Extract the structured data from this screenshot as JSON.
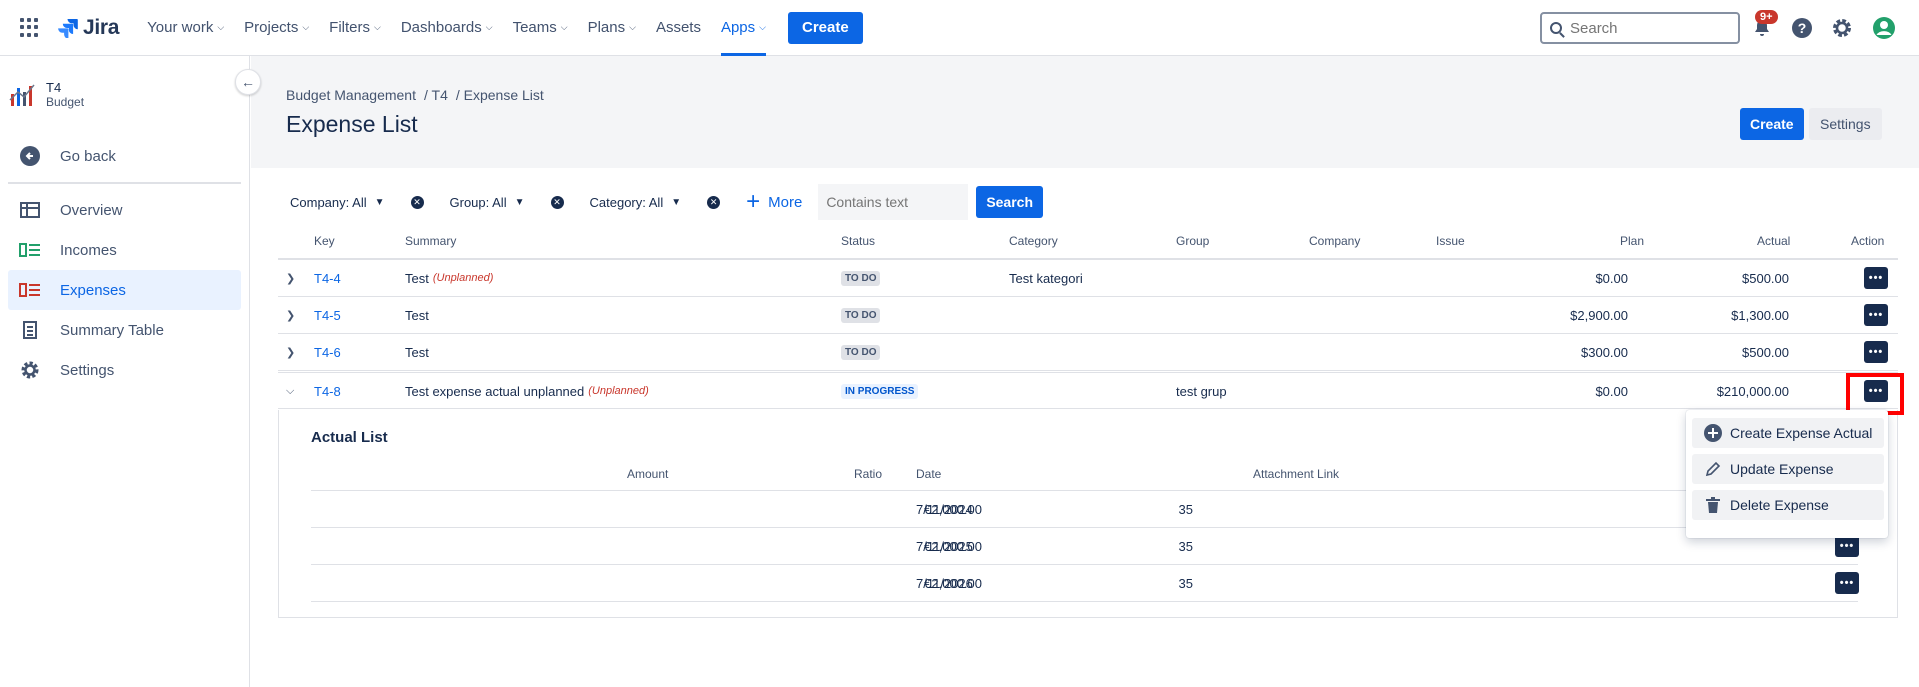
{
  "nav": {
    "logo": "Jira",
    "items": [
      {
        "label": "Your work",
        "chevron": true
      },
      {
        "label": "Projects",
        "chevron": true
      },
      {
        "label": "Filters",
        "chevron": true
      },
      {
        "label": "Dashboards",
        "chevron": true
      },
      {
        "label": "Teams",
        "chevron": true
      },
      {
        "label": "Plans",
        "chevron": true
      },
      {
        "label": "Assets",
        "chevron": false
      },
      {
        "label": "Apps",
        "chevron": true,
        "active": true
      }
    ],
    "create_label": "Create",
    "search_placeholder": "Search",
    "notifications_badge": "9+"
  },
  "sidebar": {
    "project_name": "T4",
    "project_sub": "Budget",
    "go_back": "Go back",
    "items": [
      {
        "label": "Overview",
        "icon": "overview-icon"
      },
      {
        "label": "Incomes",
        "icon": "incomes-icon"
      },
      {
        "label": "Expenses",
        "icon": "expenses-icon",
        "selected": true
      },
      {
        "label": "Summary Table",
        "icon": "summary-table-icon"
      },
      {
        "label": "Settings",
        "icon": "gear-icon"
      }
    ]
  },
  "header": {
    "breadcrumb": [
      "Budget Management",
      "/ T4",
      "/ Expense List"
    ],
    "title": "Expense List",
    "create_label": "Create",
    "settings_label": "Settings"
  },
  "filters": {
    "company": "Company: All",
    "group": "Group: All",
    "category": "Category: All",
    "more": "More",
    "contains_placeholder": "Contains text",
    "search": "Search"
  },
  "table": {
    "columns": [
      "Key",
      "Summary",
      "Status",
      "Category",
      "Group",
      "Company",
      "Issue",
      "Plan",
      "Actual",
      "Action"
    ],
    "rows": [
      {
        "key": "T4-4",
        "summary": "Test",
        "unplanned": "(Unplanned)",
        "status": "TO DO",
        "category": "Test kategori",
        "group": "",
        "plan": "$0.00",
        "actual": "$500.00"
      },
      {
        "key": "T4-5",
        "summary": "Test",
        "unplanned": "",
        "status": "TO DO",
        "category": "",
        "group": "",
        "plan": "$2,900.00",
        "actual": "$1,300.00"
      },
      {
        "key": "T4-6",
        "summary": "Test",
        "unplanned": "",
        "status": "TO DO",
        "category": "",
        "group": "",
        "plan": "$300.00",
        "actual": "$500.00"
      },
      {
        "key": "T4-8",
        "summary": "Test expense actual unplanned",
        "unplanned": "(Unplanned)",
        "status": "IN PROGRESS",
        "category": "",
        "group": "test grup",
        "plan": "$0.00",
        "actual": "$210,000.00"
      }
    ]
  },
  "actual_list": {
    "title": "Actual List",
    "columns": [
      "Amount",
      "Ratio",
      "Date",
      "Attachment Link"
    ],
    "rows": [
      {
        "amount": "€2,000.00",
        "ratio": "35",
        "date": "7/11/2024"
      },
      {
        "amount": "€2,000.00",
        "ratio": "35",
        "date": "7/11/2025"
      },
      {
        "amount": "€2,000.00",
        "ratio": "35",
        "date": "7/11/2026"
      }
    ]
  },
  "action_menu": {
    "items": [
      "Create Expense Actual",
      "Update Expense",
      "Delete Expense"
    ]
  },
  "colors": {
    "brand": "#0c66e4",
    "unplanned": "#c9372c",
    "highlight": "#ff0000"
  }
}
